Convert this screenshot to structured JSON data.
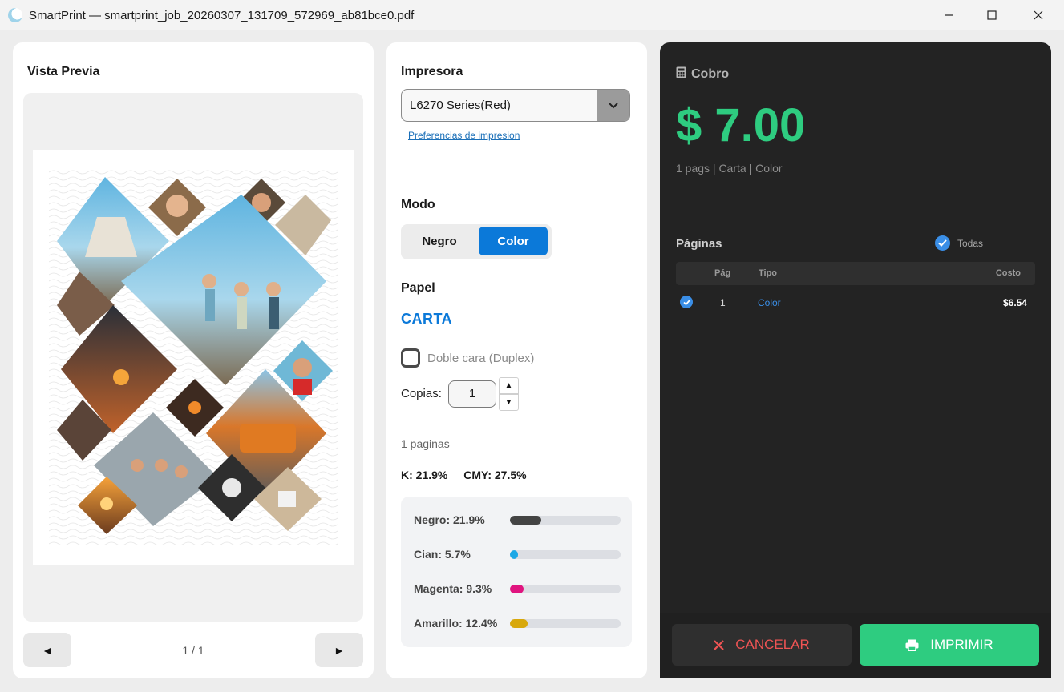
{
  "window": {
    "title": "SmartPrint — smartprint_job_20260307_131709_572969_ab81bce0.pdf"
  },
  "preview": {
    "title": "Vista Previa",
    "page_counter": "1 / 1",
    "prev_label": "◄",
    "next_label": "►"
  },
  "settings": {
    "printer_title": "Impresora",
    "printer_value": "L6270 Series(Red)",
    "preferences_link": "Preferencias de impresion",
    "mode_title": "Modo",
    "mode_black": "Negro",
    "mode_color": "Color",
    "mode_selected": "Color",
    "paper_title": "Papel",
    "paper_value": "CARTA",
    "duplex_label": "Doble cara (Duplex)",
    "duplex_checked": false,
    "copies_label": "Copias:",
    "copies_value": "1",
    "pages_count": "1 paginas",
    "coverage_k": "K: 21.9%",
    "coverage_cmy": "CMY: 27.5%",
    "inks": [
      {
        "label": "Negro: 21.9%",
        "percent": 21.9,
        "color": "#444444"
      },
      {
        "label": "Cian: 5.7%",
        "percent": 5.7,
        "color": "#1ba8e6"
      },
      {
        "label": "Magenta: 9.3%",
        "percent": 9.3,
        "color": "#e0147f"
      },
      {
        "label": "Amarillo: 12.4%",
        "percent": 12.4,
        "color": "#d8a80c"
      }
    ]
  },
  "billing": {
    "title": "Cobro",
    "amount": "$ 7.00",
    "summary": "1 pags | Carta | Color",
    "pages_title": "Páginas",
    "select_all_label": "Todas",
    "columns": {
      "page": "Pág",
      "type": "Tipo",
      "cost": "Costo"
    },
    "rows": [
      {
        "page": "1",
        "type": "Color",
        "cost": "$6.54",
        "checked": true
      }
    ],
    "cancel_label": "CANCELAR",
    "print_label": "IMPRIMIR"
  },
  "colors": {
    "accent_blue": "#0b79d9",
    "money_green": "#2ecc80",
    "cancel_red": "#f05454"
  }
}
